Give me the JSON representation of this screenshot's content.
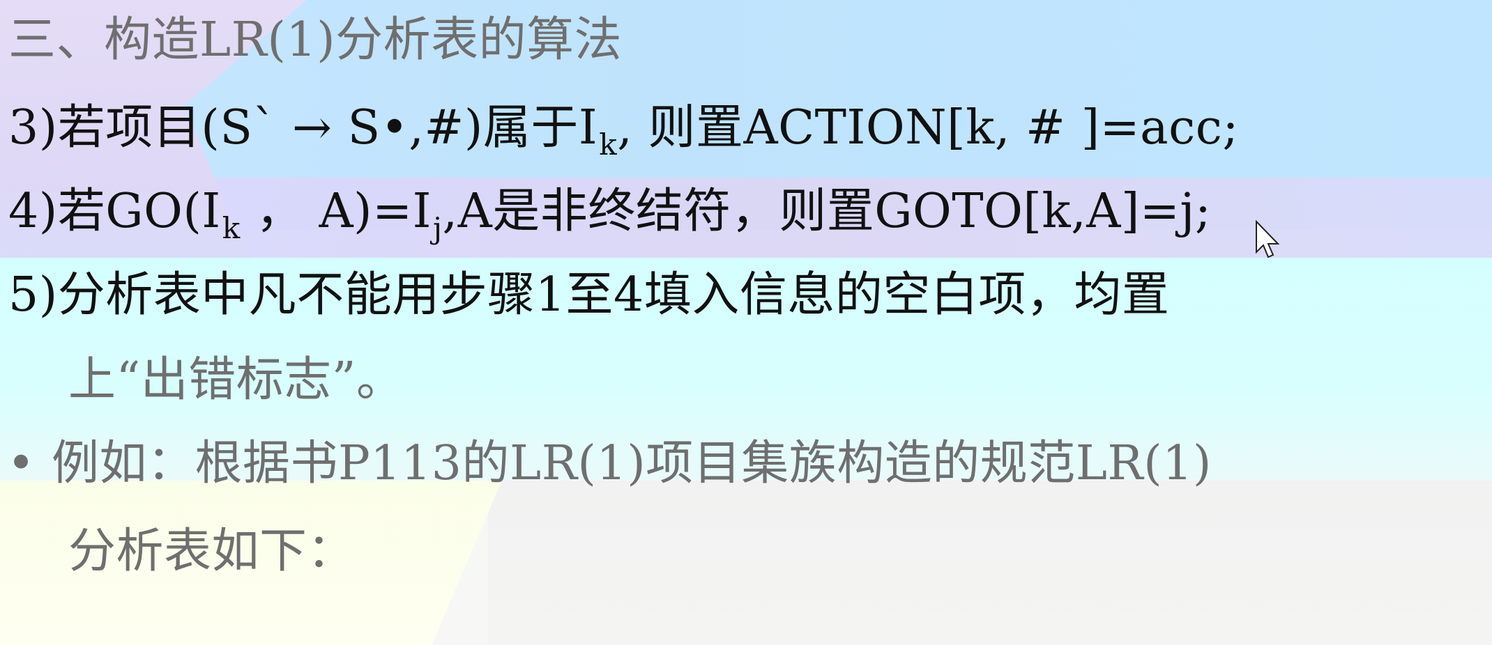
{
  "slide": {
    "title": "三、构造LR(1)分析表的算法",
    "rule3": "3)若项目(S` → S•,#)属于I",
    "rule3_sub": "k",
    "rule3_tail": ", 则置ACTION[k, # ]=acc;",
    "rule4": "4)若GO(I",
    "rule4_sub1": "k",
    "rule4_mid": " ，  A)=I",
    "rule4_sub2": "j",
    "rule4_tail": ",A是非终结符，则置GOTO[k,A]=j;",
    "rule5_line1": "5)分析表中凡不能用步骤1至4填入信息的空白项，均置",
    "rule5_line2": "上“出错标志”。",
    "bullet": "•",
    "example_line1": "例如：根据书P113的LR(1)项目集族构造的规范LR(1)",
    "example_line2": "分析表如下："
  },
  "colors": {
    "top_blue": "#c6e6ff",
    "purple_band": "#dcd6f4",
    "cyan": "#d7ffff",
    "yellow": "#fffff0",
    "text_dark": "#111111",
    "text_gray": "#6f6f6f"
  },
  "icons": {
    "cursor": "mouse-pointer-icon"
  }
}
